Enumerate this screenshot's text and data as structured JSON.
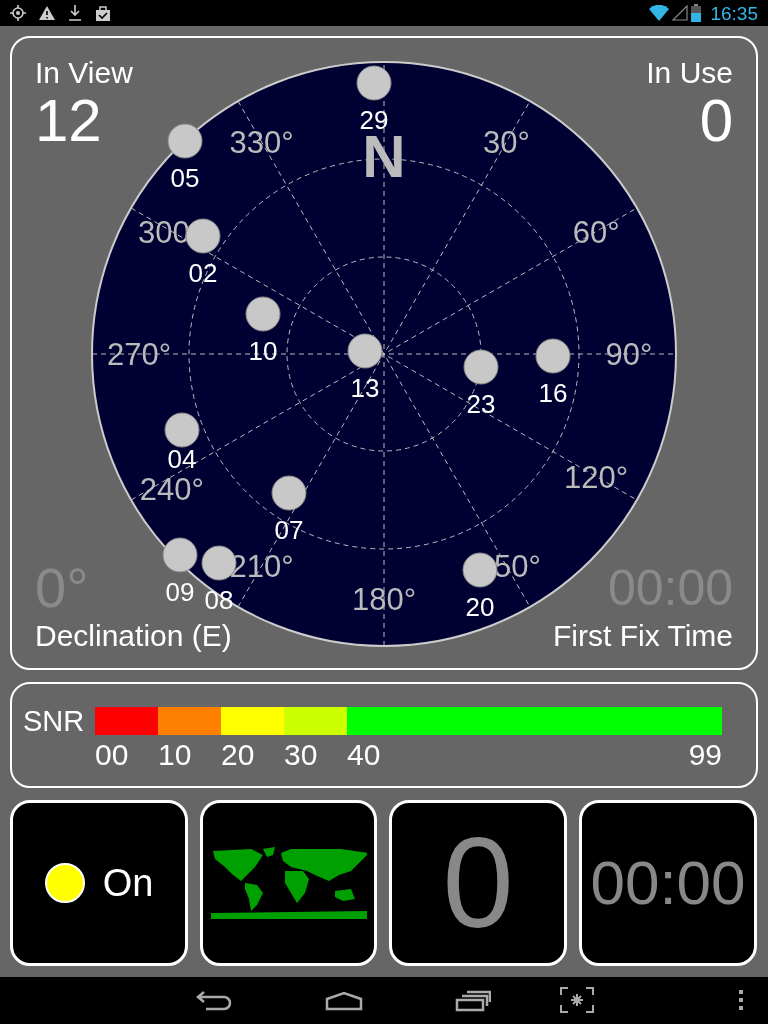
{
  "status_bar": {
    "time": "16:35"
  },
  "sky_view": {
    "in_view": {
      "label": "In View",
      "value": "12"
    },
    "in_use": {
      "label": "In Use",
      "value": "0"
    },
    "declination": {
      "label": "Declination (E)",
      "value": "0°"
    },
    "first_fix": {
      "label": "First Fix Time",
      "value": "00:00"
    },
    "north": "N",
    "bearings": [
      "30°",
      "60°",
      "90°",
      "120°",
      "50°",
      "180°",
      "210°",
      "240°",
      "270°",
      "300",
      "330°"
    ],
    "satellites": [
      {
        "id": "29"
      },
      {
        "id": "05"
      },
      {
        "id": "02"
      },
      {
        "id": "10"
      },
      {
        "id": "13"
      },
      {
        "id": "23"
      },
      {
        "id": "16"
      },
      {
        "id": "04"
      },
      {
        "id": "07"
      },
      {
        "id": "09"
      },
      {
        "id": "08"
      },
      {
        "id": "20"
      }
    ]
  },
  "snr": {
    "label": "SNR",
    "segments": [
      {
        "label": "00",
        "color": "#ff0000"
      },
      {
        "label": "10",
        "color": "#ff8000"
      },
      {
        "label": "20",
        "color": "#ffff00"
      },
      {
        "label": "30",
        "color": "#ccff00"
      },
      {
        "label": "40",
        "color": "#00ff00"
      }
    ],
    "max_label": "99"
  },
  "tiles": {
    "gps": {
      "on": true,
      "label": "On"
    },
    "satellites_in_use": "0",
    "fix_time": "00:00"
  }
}
